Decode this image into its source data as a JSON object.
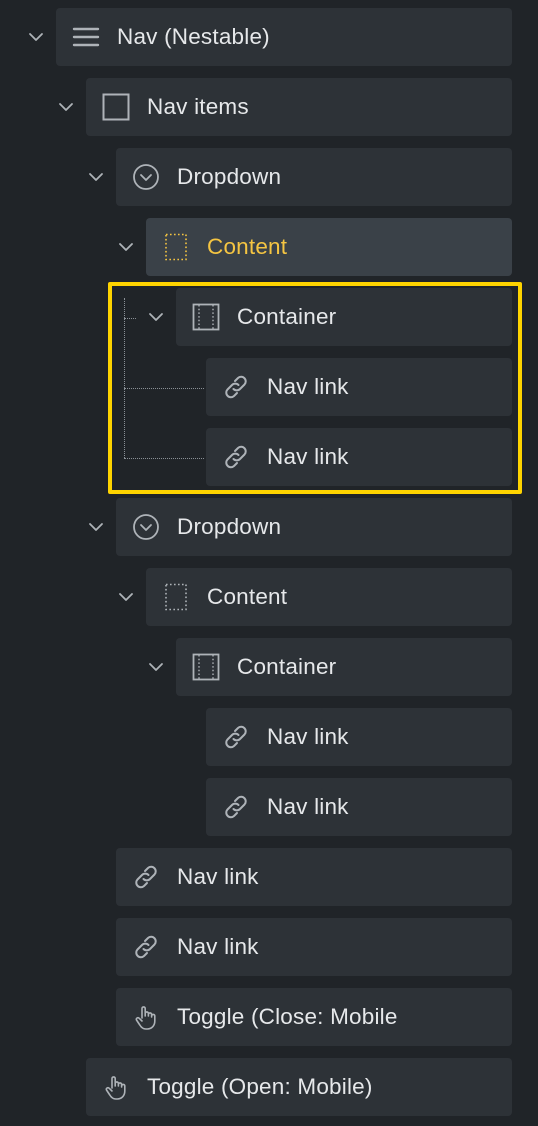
{
  "structure_tree": {
    "items": [
      {
        "label": "Nav (Nestable)",
        "icon": "hamburger-icon",
        "expanded": true
      },
      {
        "label": "Nav items",
        "icon": "square-icon",
        "expanded": true
      },
      {
        "label": "Dropdown",
        "icon": "chevron-circle-icon",
        "expanded": true
      },
      {
        "label": "Content",
        "icon": "dotted-box-icon",
        "expanded": true,
        "active": true
      },
      {
        "label": "Container",
        "icon": "container-icon",
        "expanded": true
      },
      {
        "label": "Nav link",
        "icon": "link-icon"
      },
      {
        "label": "Nav link",
        "icon": "link-icon"
      },
      {
        "label": "Dropdown",
        "icon": "chevron-circle-icon",
        "expanded": true
      },
      {
        "label": "Content",
        "icon": "dotted-box-icon",
        "expanded": true
      },
      {
        "label": "Container",
        "icon": "container-icon",
        "expanded": true
      },
      {
        "label": "Nav link",
        "icon": "link-icon"
      },
      {
        "label": "Nav link",
        "icon": "link-icon"
      },
      {
        "label": "Nav link",
        "icon": "link-icon"
      },
      {
        "label": "Nav link",
        "icon": "link-icon"
      },
      {
        "label": "Toggle (Close: Mobile",
        "icon": "hand-pointer-icon"
      },
      {
        "label": "Toggle (Open: Mobile)",
        "icon": "hand-pointer-icon"
      }
    ]
  },
  "colors": {
    "background": "#202428",
    "row": "#2d3237",
    "row_active": "#3a4148",
    "accent_text": "#f5c542",
    "highlight_border": "#ffd400"
  }
}
